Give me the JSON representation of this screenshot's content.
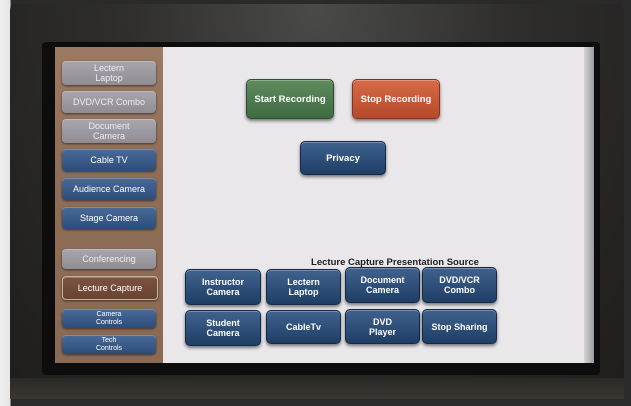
{
  "sidebar": {
    "items": [
      {
        "label": "Lectern Laptop"
      },
      {
        "label": "DVD/VCR Combo"
      },
      {
        "label": "Document Camera"
      },
      {
        "label": "Cable TV"
      },
      {
        "label": "Audience Camera"
      },
      {
        "label": "Stage Camera"
      },
      {
        "label": "Conferencing"
      },
      {
        "label": "Lecture Capture"
      },
      {
        "label": "Camera Controls"
      },
      {
        "label": "Tech Controls"
      }
    ]
  },
  "recording": {
    "start_label": "Start Recording",
    "stop_label": "Stop Recording",
    "privacy_label": "Privacy"
  },
  "source": {
    "title": "Lecture Capture Presentation Source",
    "buttons": [
      {
        "label": "Instructor Camera"
      },
      {
        "label": "Lectern Laptop"
      },
      {
        "label": "Document Camera"
      },
      {
        "label": "DVD/VCR Combo"
      },
      {
        "label": "Student Camera"
      },
      {
        "label": "CableTv"
      },
      {
        "label": "DVD Player"
      },
      {
        "label": "Stop Sharing"
      }
    ]
  },
  "colors": {
    "sidebar": "#8f6e57",
    "start": "#4a7a4c",
    "stop": "#c4543a",
    "navy": "#2c4d7a",
    "screen_bg": "#e9e7ea"
  }
}
